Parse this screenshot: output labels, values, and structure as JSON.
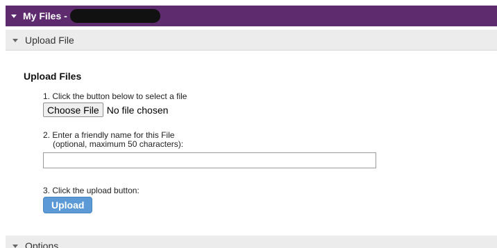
{
  "title_bar": {
    "title": "My Files -"
  },
  "upload_section": {
    "header": "Upload File",
    "title": "Upload Files",
    "step1": "1. Click the button below to select a file",
    "choose_label": "Choose File",
    "file_status": "No file chosen",
    "step2_line1": "2. Enter a friendly name for this File",
    "step2_line2": "(optional, maximum 50 characters):",
    "friendly_name_value": "",
    "step3": "3. Click the upload button:",
    "upload_label": "Upload"
  },
  "options_section": {
    "header": "Options"
  },
  "colors": {
    "title_bar": "#5e2b6e",
    "upload_button": "#5b9ad6",
    "section_header": "#ececec"
  }
}
